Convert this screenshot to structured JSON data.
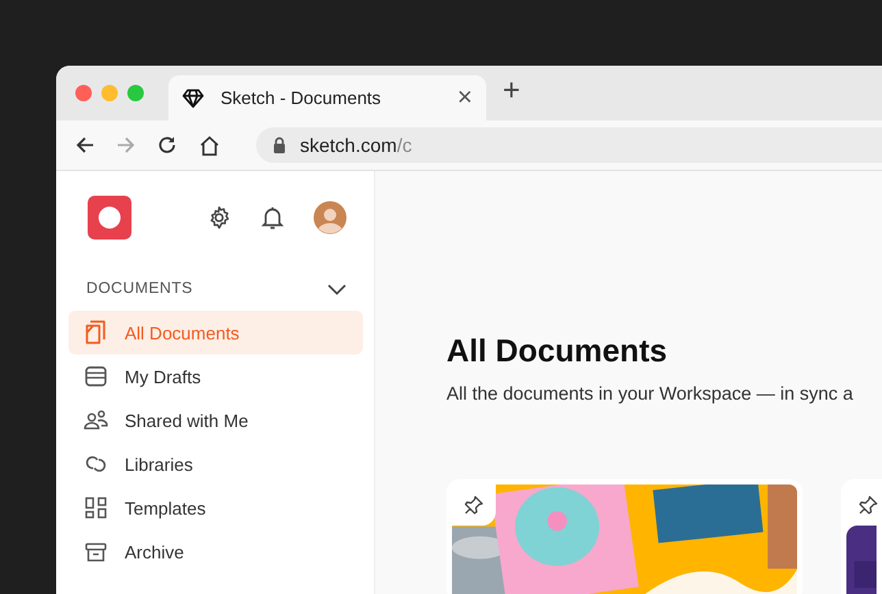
{
  "browser": {
    "tab": {
      "title": "Sketch - Documents",
      "close": "×"
    },
    "new_tab": "+",
    "address": {
      "host": "sketch.com",
      "path": "/c"
    },
    "forward_disabled": true
  },
  "sidebar": {
    "section": {
      "title": "DOCUMENTS",
      "expanded": true
    },
    "items": [
      {
        "label": "All Documents",
        "selected": true
      },
      {
        "label": "My Drafts",
        "selected": false
      },
      {
        "label": "Shared with Me",
        "selected": false
      },
      {
        "label": "Libraries",
        "selected": false
      },
      {
        "label": "Templates",
        "selected": false
      },
      {
        "label": "Archive",
        "selected": false
      }
    ]
  },
  "main": {
    "title": "All Documents",
    "subtitle": "All the documents in your Workspace — in sync a"
  }
}
